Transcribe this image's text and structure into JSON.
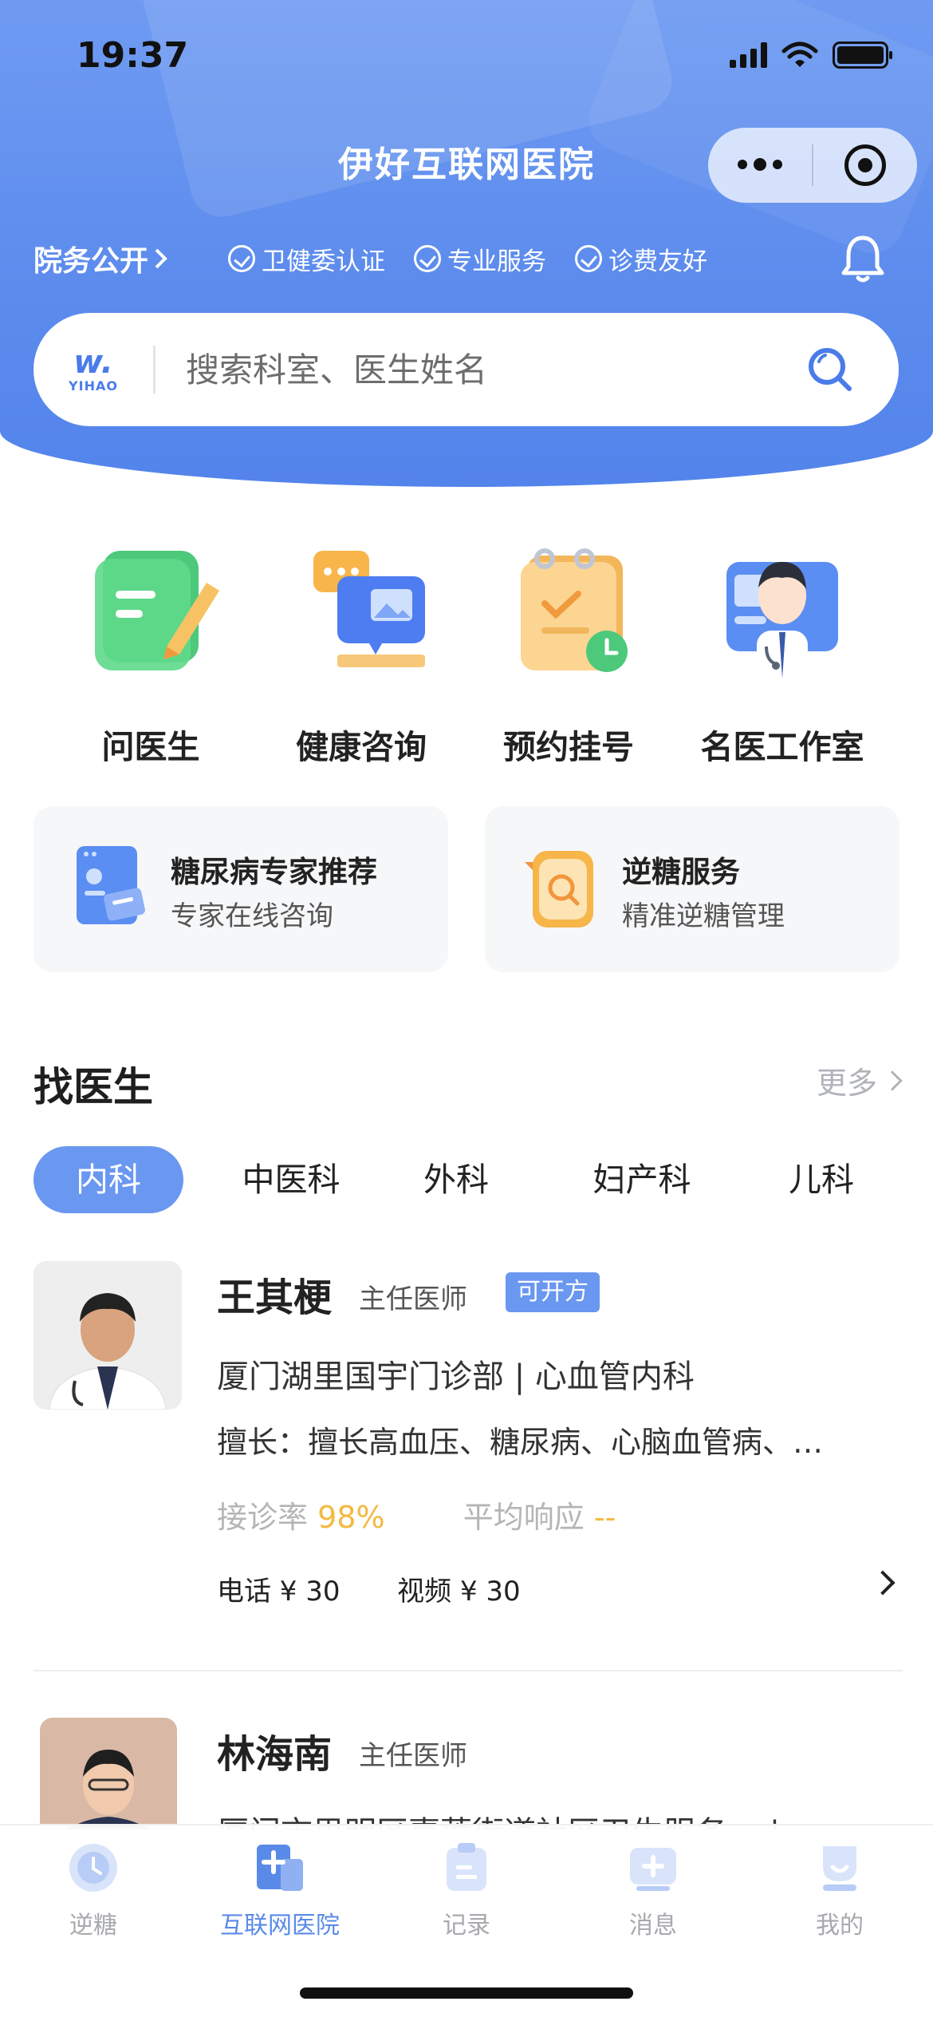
{
  "status_bar": {
    "time": "19:37"
  },
  "app": {
    "title": "伊好互联网医院"
  },
  "info_row": {
    "affairs_label": "院务公开",
    "badges": [
      "卫健委认证",
      "专业服务",
      "诊费友好"
    ]
  },
  "search": {
    "logo_text": "YIHAO",
    "placeholder": "搜索科室、医生姓名"
  },
  "quick_menu": [
    {
      "label": "问医生",
      "icon": "edit-note-icon"
    },
    {
      "label": "健康咨询",
      "icon": "chat-image-icon"
    },
    {
      "label": "预约挂号",
      "icon": "calendar-clock-icon"
    },
    {
      "label": "名医工作室",
      "icon": "doctor-icon"
    }
  ],
  "service_cards": [
    {
      "title": "糖尿病专家推荐",
      "subtitle": "专家在线咨询",
      "icon": "id-card-icon"
    },
    {
      "title": "逆糖服务",
      "subtitle": "精准逆糖管理",
      "icon": "search-box-icon"
    }
  ],
  "find_doctor": {
    "title": "找医生",
    "more": "更多",
    "tabs": [
      "内科",
      "中医科",
      "外科",
      "妇产科",
      "儿科"
    ],
    "active_tab": "内科"
  },
  "doctors": [
    {
      "name": "王其梗",
      "title": "主任医师",
      "tag": "可开方",
      "hospital": "厦门湖里国宇门诊部 | 心血管内科",
      "specialty": "擅长：擅长高血压、糖尿病、心脑血管病、…",
      "rate_label": "接诊率",
      "rate_value": "98%",
      "response_label": "平均响应",
      "response_value": "--",
      "phone_price": "电话 ¥ 30",
      "video_price": "视频 ¥ 30"
    },
    {
      "name": "林海南",
      "title": "主任医师",
      "hospital": "厦门市思明区嘉莲街道社区卫生服务…  |"
    }
  ],
  "tabbar": [
    {
      "label": "逆糖",
      "icon": "clock-icon"
    },
    {
      "label": "互联网医院",
      "icon": "hospital-icon",
      "active": true
    },
    {
      "label": "记录",
      "icon": "clipboard-icon"
    },
    {
      "label": "消息",
      "icon": "message-plus-icon"
    },
    {
      "label": "我的",
      "icon": "profile-icon"
    }
  ],
  "colors": {
    "brand_blue": "#5c8bed",
    "tab_active": "#6a97f0",
    "highlight": "#f3b941"
  }
}
